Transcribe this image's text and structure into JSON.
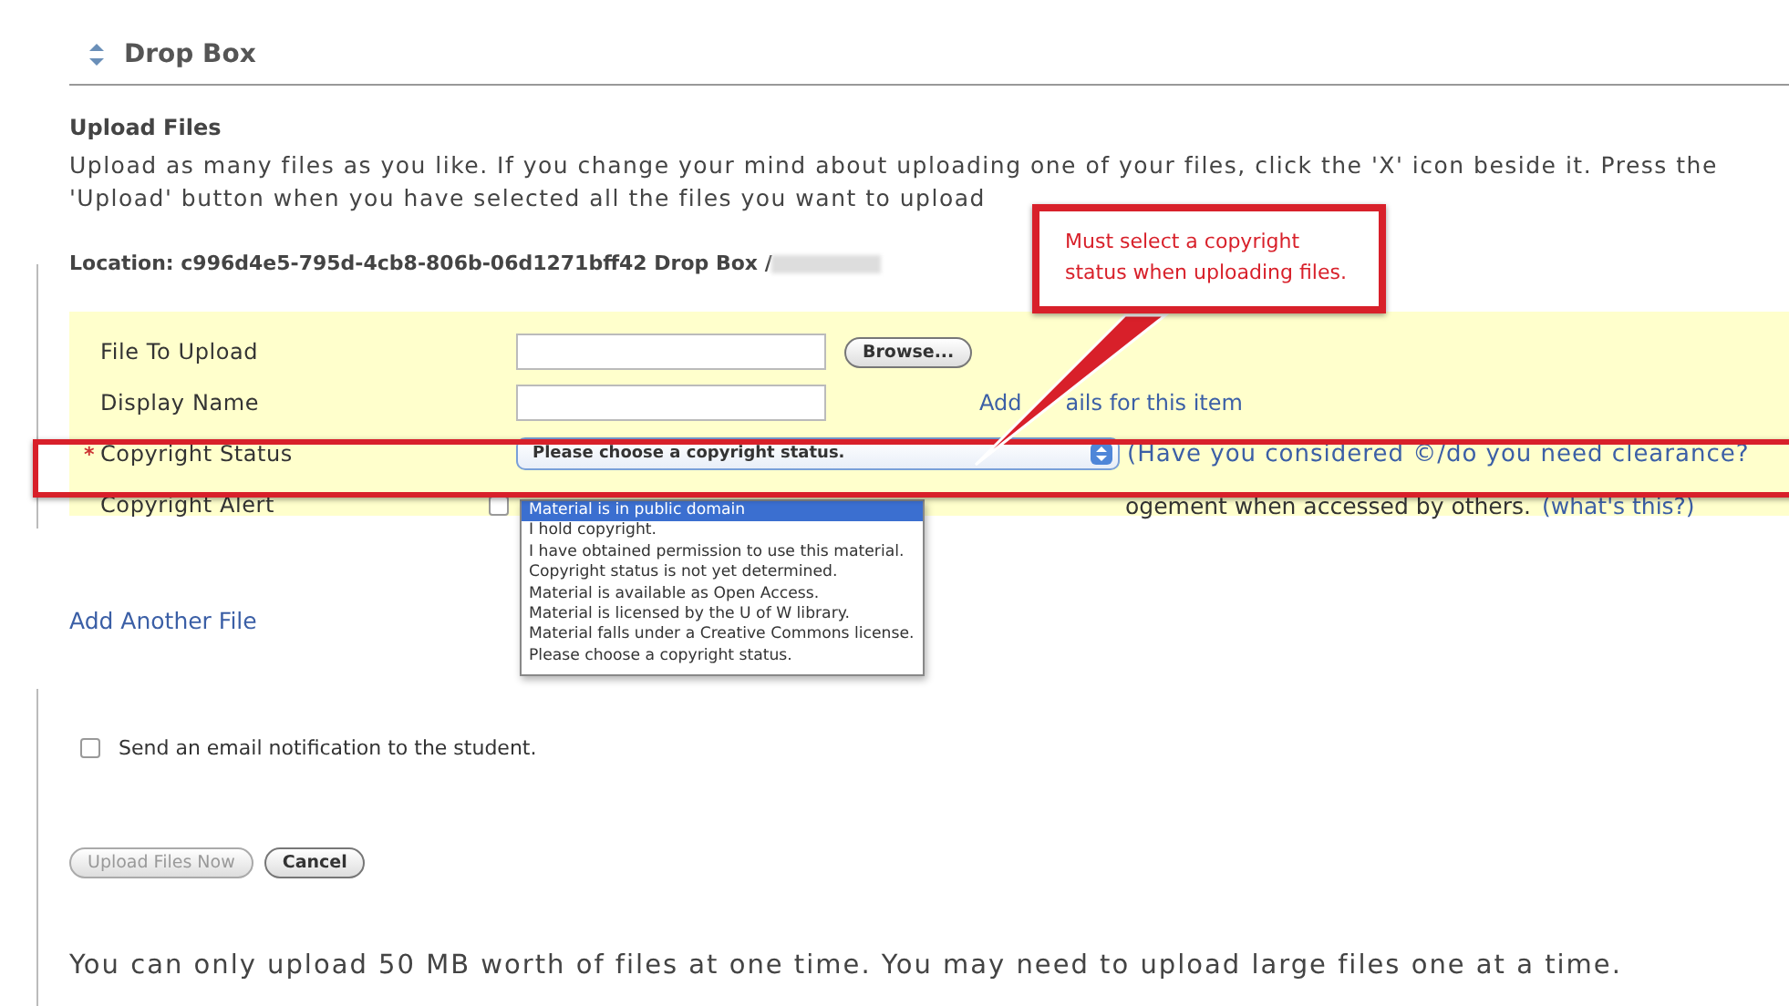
{
  "header": {
    "title": "Drop Box"
  },
  "section_title": "Upload Files",
  "instructions": [
    "Upload as many files as you like. If you change your mind about uploading one of your files, click the 'X' icon beside it. Press the",
    "'Upload' button when you have selected all the files you want to upload"
  ],
  "required_mark": "*",
  "location": "Location: c996d4e5-795d-4cb8-806b-06d1271bff42 Drop Box / ",
  "form": [
    {
      "kind": "file",
      "label": "File To Upload",
      "required": false,
      "button": "Browse..."
    },
    {
      "kind": "text",
      "label": "Display Name",
      "required": false,
      "link_parts": [
        "Add",
        "ails for this item"
      ]
    },
    {
      "kind": "select",
      "label": "Copyright Status",
      "required": true,
      "value": "Please choose a copyright status.",
      "note": "(Have you considered ©/do you need clearance?"
    },
    {
      "kind": "checkbox",
      "label": "Copyright Alert",
      "required": false,
      "checked": false,
      "text": "ogement when accessed by others.",
      "link": "(what's this?)"
    }
  ],
  "dropdown": {
    "options": [
      {
        "label": "Material is in public domain",
        "selected": true
      },
      {
        "label": "I hold copyright.",
        "selected": false
      },
      {
        "label": "I have obtained permission to use this material.",
        "selected": false
      },
      {
        "label": "Copyright status is not yet determined.",
        "selected": false
      },
      {
        "label": "Material is available as Open Access.",
        "selected": false
      },
      {
        "label": "Material is licensed by the U of W library.",
        "selected": false
      },
      {
        "label": "Material falls under a Creative Commons license.",
        "selected": false
      },
      {
        "label": "Please choose a copyright status.",
        "selected": false
      }
    ]
  },
  "callout": {
    "text": "Must select a copyright status when uploading files."
  },
  "add_another": "Add Another File",
  "notify": {
    "label": "Send an email notification to the student.",
    "checked": false
  },
  "buttons": [
    {
      "label": "Upload Files Now",
      "disabled": true
    },
    {
      "label": "Cancel",
      "disabled": false
    }
  ],
  "footer": "You can only upload 50 MB worth of files at one time. You may need to upload large files one at a time."
}
